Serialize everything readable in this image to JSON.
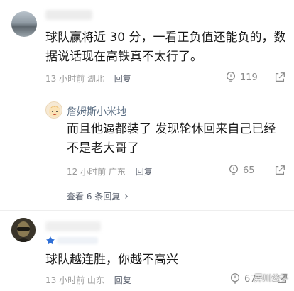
{
  "comments": [
    {
      "text": "球队赢将近 30 分，一看正负值还能负的，数据说话现在高铁真不太行了。",
      "time": "13 小时前",
      "location": "湖北",
      "reply_label": "回复",
      "likes": "119"
    }
  ],
  "reply": {
    "author": "詹姆斯小米地",
    "text": "而且他逼都装了 发现轮休回来自己已经不是老大哥了",
    "time": "12 小时前",
    "location": "广东",
    "reply_label": "回复",
    "likes": "65"
  },
  "more_replies": "查看 6 条回复",
  "comment3": {
    "text": "球队越连胜，你越不高兴",
    "time": "13 小时前",
    "location": "山东",
    "reply_label": "回复",
    "likes": "67"
  },
  "watermark": "弄川公子",
  "colors": {
    "name_link": "#5c6f84",
    "meta_gray": "#9a9a9a",
    "star_blue": "#2f6fd6"
  }
}
